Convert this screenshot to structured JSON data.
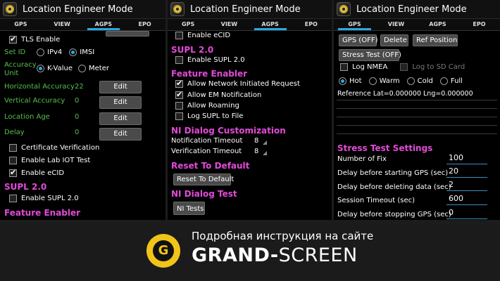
{
  "app": {
    "title": "Location Engineer Mode"
  },
  "tabs": [
    "GPS",
    "VIEW",
    "AGPS",
    "EPO"
  ],
  "panel1": {
    "active_tab": "AGPS",
    "tls_label": "TLS Enable",
    "set_id_label": "Set ID",
    "set_id_options": [
      "IPv4",
      "IMSI"
    ],
    "set_id_selected": "IMSI",
    "accuracy_label_1": "Accuracy",
    "accuracy_label_2": "Unit",
    "accuracy_options": [
      "K-Value",
      "Meter"
    ],
    "accuracy_selected": "K-Value",
    "horizontal_label": "Horizontal Accuracy",
    "horizontal_value": "22",
    "vertical_label": "Vertical Accuracy",
    "vertical_value": "0",
    "location_age_label": "Location Age",
    "location_age_value": "0",
    "delay_label": "Delay",
    "delay_value": "0",
    "edit_label": "Edit",
    "cert_label": "Certificate Verification",
    "lab_iot_label": "Enable Lab IOT Test",
    "ecid_label": "Enable eCID",
    "supl_header": "SUPL 2.0",
    "supl_label": "Enable SUPL 2.0",
    "feature_header": "Feature Enabler"
  },
  "panel2": {
    "active_tab": "AGPS",
    "ecid_label": "Enable eCID",
    "supl_header": "SUPL 2.0",
    "supl_label": "Enable SUPL 2.0",
    "feature_header": "Feature Enabler",
    "ni_request_label": "Allow Network Initiated Request",
    "em_notification_label": "Allow EM Notification",
    "roaming_label": "Allow Roaming",
    "log_supl_label": "Log SUPL to File",
    "ni_dialog_header": "NI Dialog Customization",
    "notification_timeout_label": "Notification Timeout",
    "notification_timeout_value": "8",
    "verification_timeout_label": "Verification Timeout",
    "verification_timeout_value": "8",
    "reset_header": "Reset To Default",
    "reset_button": "Reset To Default",
    "ni_test_header": "NI Dialog Test",
    "ni_test_button": "NI Tests"
  },
  "panel3": {
    "active_tab": "GPS",
    "gps_off_button": "GPS (OFF)",
    "delete_button": "Delete",
    "ref_position_button": "Ref Position",
    "stress_test_button": "Stress Test (OFF)",
    "log_nmea_label": "Log NMEA",
    "log_sd_label": "Log to SD Card",
    "start_options": [
      "Hot",
      "Warm",
      "Cold",
      "Full"
    ],
    "start_selected": "Hot",
    "reference_text": "Reference Lat=0.000000 Lng=0.000000",
    "stress_header": "Stress Test Settings",
    "fields": [
      {
        "label": "Number of Fix",
        "value": "100"
      },
      {
        "label": "Delay before starting GPS (sec)",
        "value": "20"
      },
      {
        "label": "Delay before deleting data (sec)",
        "value": "2"
      },
      {
        "label": "Session Timeout (sec)",
        "value": "600"
      },
      {
        "label": "Delay before stopping GPS (sec)",
        "value": "0"
      }
    ]
  },
  "banner": {
    "logo_letter": "G",
    "line1": "Подробная инструкция на сайте",
    "brand_bold": "GRAND-",
    "brand_thin": "SCREEN"
  },
  "colors": {
    "accent": "#2aa9e0",
    "section_header": "#e24ad8",
    "green_label": "#54c04d",
    "logo_yellow": "#f0c419"
  }
}
